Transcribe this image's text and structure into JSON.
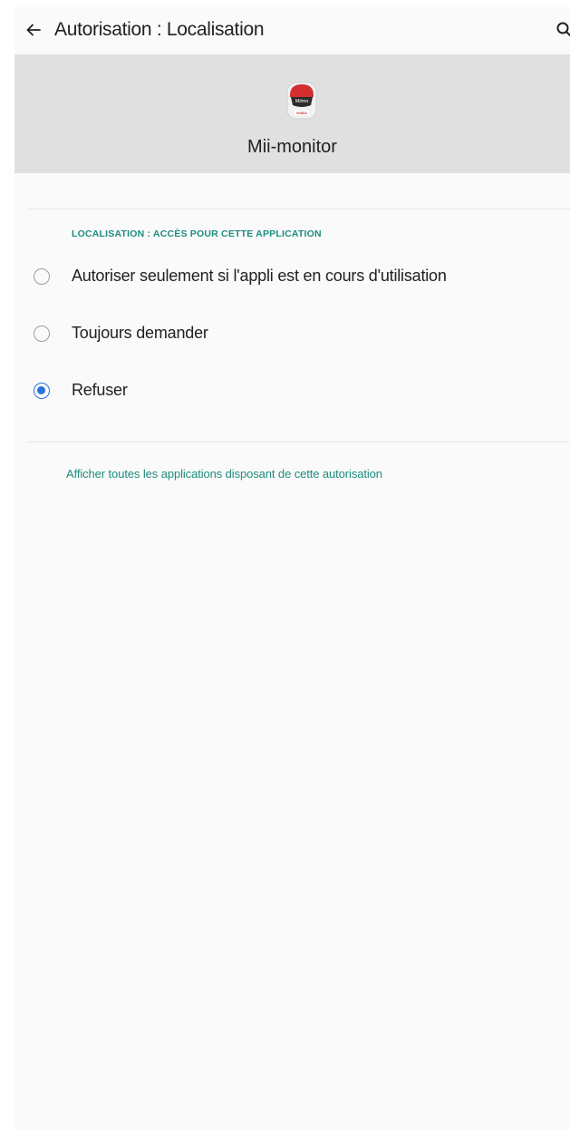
{
  "toolbar": {
    "back_icon": "arrow-left-icon",
    "title": "Autorisation : Localisation",
    "search_icon": "search-icon"
  },
  "app": {
    "name": "Mii-monitor",
    "icon": "mii-monitor-app-icon",
    "icon_text": "Miimo",
    "brand_text": "HONDA",
    "accent_color": "#d32f2f"
  },
  "permission": {
    "section_header": "LOCALISATION : ACCÈS POUR CETTE APPLICATION",
    "options": [
      {
        "label": "Autoriser seulement si l'appli est en cours d'utilisation",
        "checked": false
      },
      {
        "label": "Toujours demander",
        "checked": false
      },
      {
        "label": "Refuser",
        "checked": true
      }
    ],
    "selected_color": "#2a74e0"
  },
  "footer": {
    "link": "Afficher toutes les applications disposant de cette autorisation",
    "link_color": "#1e8c7e"
  }
}
